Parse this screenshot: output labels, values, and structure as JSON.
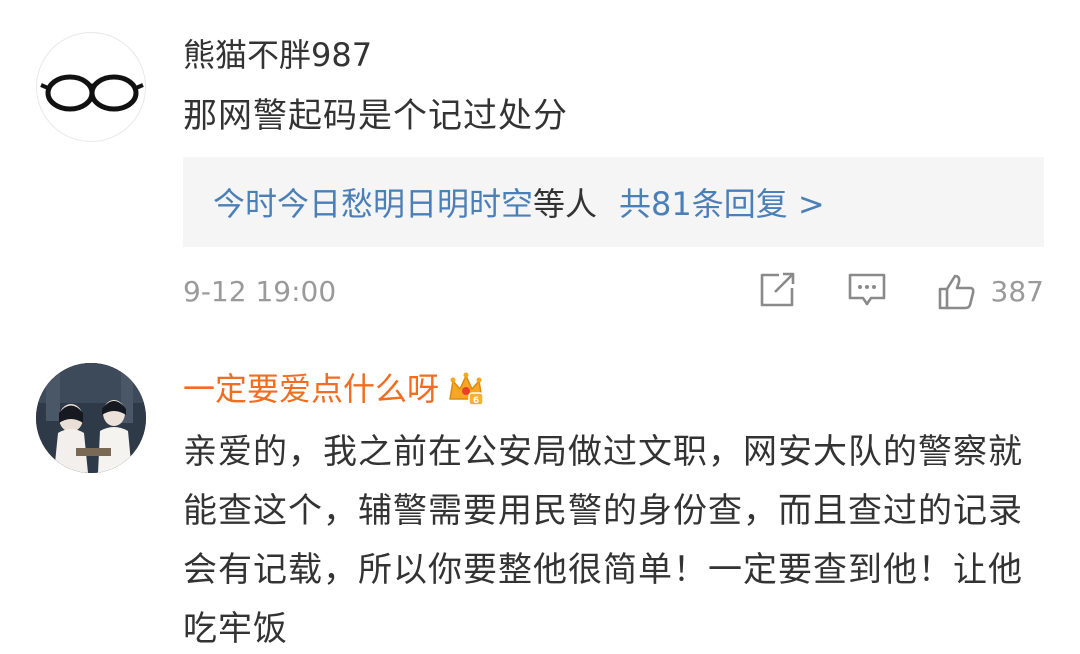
{
  "comments": [
    {
      "username": "熊猫不胖987",
      "text": "那网警起码是个记过处分",
      "replies": {
        "users": "今时今日愁明日明时空",
        "suffix": "等人",
        "count": "共81条回复 >"
      },
      "time": "9-12 19:00",
      "likes": "387",
      "icons": [
        "glasses-avatar",
        "share-icon",
        "comment-icon",
        "like-icon"
      ]
    },
    {
      "username": "一定要爱点什么呀",
      "badge_icon": "crown-badge-icon",
      "text": "亲爱的，我之前在公安局做过文职，网安大队的警察就能查这个，辅警需要用民警的身份查，而且查过的记录会有记载，所以你要整他很简单！一定要查到他！让他吃牢饭"
    }
  ],
  "colors": {
    "link_blue": "#4a7fb8",
    "vip_orange": "#f26d1f",
    "meta_gray": "#9a9a9a",
    "reply_bg": "#f5f5f5"
  }
}
